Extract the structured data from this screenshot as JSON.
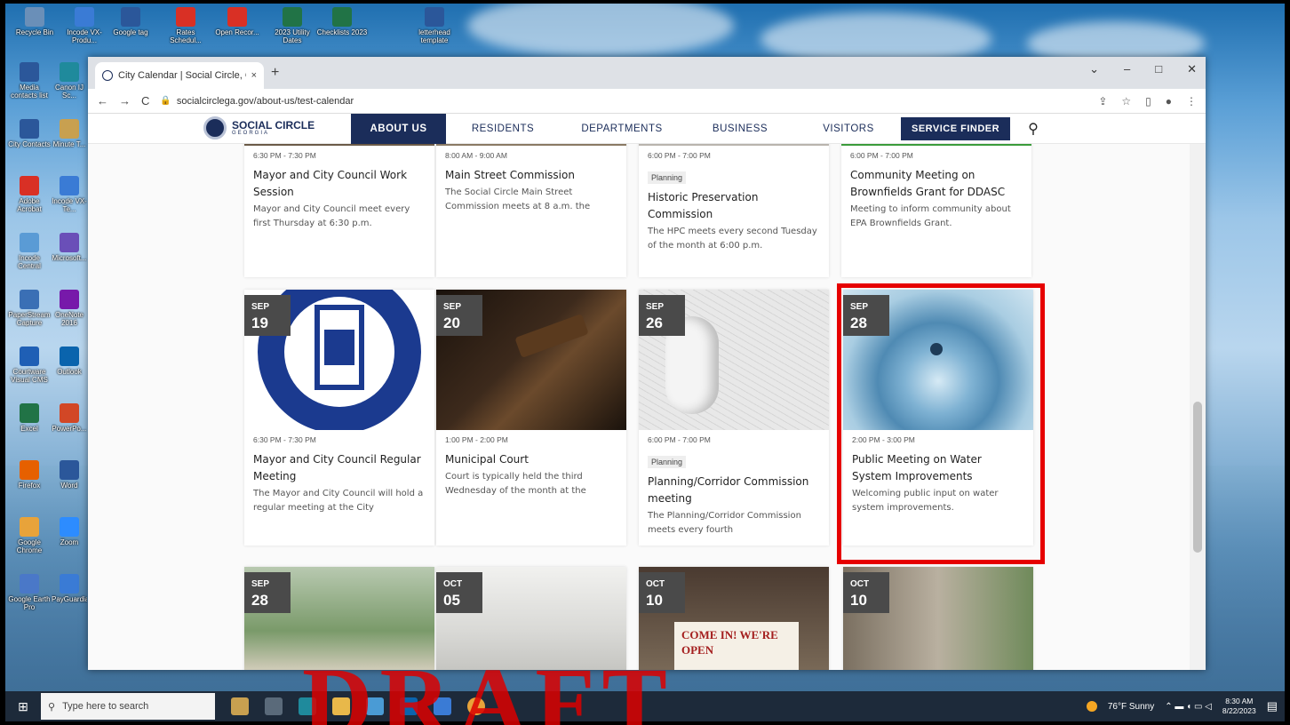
{
  "desktop": {
    "top_icons": [
      {
        "label": "Recycle Bin",
        "icon": "recycle-bin-icon",
        "color": "#6a8fb8"
      },
      {
        "label": "Incode VX-Produ...",
        "icon": "incode-icon",
        "color": "#3a7bd5"
      },
      {
        "label": "Google tag",
        "icon": "word-icon",
        "color": "#2b579a"
      },
      {
        "label": "Rates Schedul...",
        "icon": "pdf-icon",
        "color": "#d93025"
      },
      {
        "label": "Open Recor...",
        "icon": "pdf-icon",
        "color": "#d93025"
      },
      {
        "label": "2023 Utility Dates",
        "icon": "excel-icon",
        "color": "#217346"
      },
      {
        "label": "Checklists 2023",
        "icon": "excel-icon",
        "color": "#217346"
      },
      {
        "label": "letterhead template",
        "icon": "word-icon",
        "color": "#2b579a"
      }
    ],
    "left_icons": [
      {
        "label": "Media contacts list",
        "icon": "word-icon",
        "color": "#2b579a"
      },
      {
        "label": "Canon IJ Sc...",
        "icon": "edge-icon",
        "color": "#1f8a9c"
      },
      {
        "label": "City Contacts",
        "icon": "word-icon",
        "color": "#2b579a"
      },
      {
        "label": "Minute T...",
        "icon": "minute-icon",
        "color": "#c8a050"
      },
      {
        "label": "Adobe Acrobat",
        "icon": "pdf-icon",
        "color": "#d93025"
      },
      {
        "label": "Incode VX-Te...",
        "icon": "incode-icon",
        "color": "#3a7bd5"
      },
      {
        "label": "Incode Central",
        "icon": "incode-central-icon",
        "color": "#5a9bd5"
      },
      {
        "label": "Microsoft...",
        "icon": "microsoft-icon",
        "color": "#6a4fb8"
      },
      {
        "label": "PaperStream Capture",
        "icon": "paperstream-icon",
        "color": "#3a6fb5"
      },
      {
        "label": "OneNote 2016",
        "icon": "onenote-icon",
        "color": "#7719aa"
      },
      {
        "label": "Courtware Visual CMS",
        "icon": "courtware-icon",
        "color": "#1f5fb5"
      },
      {
        "label": "Outlook",
        "icon": "outlook-icon",
        "color": "#0a64ad"
      },
      {
        "label": "Excel",
        "icon": "excel-icon",
        "color": "#217346"
      },
      {
        "label": "PowerPo...",
        "icon": "powerpoint-icon",
        "color": "#d24726"
      },
      {
        "label": "Firefox",
        "icon": "firefox-icon",
        "color": "#e66000"
      },
      {
        "label": "Word",
        "icon": "word-icon",
        "color": "#2b579a"
      },
      {
        "label": "Google Chrome",
        "icon": "chrome-icon",
        "color": "#e8a33a"
      },
      {
        "label": "Zoom",
        "icon": "zoom-icon",
        "color": "#2d8cff"
      },
      {
        "label": "Google Earth Pro",
        "icon": "google-earth-icon",
        "color": "#4a78c8"
      },
      {
        "label": "PayGuardian",
        "icon": "payguardian-icon",
        "color": "#3a7bd5"
      }
    ]
  },
  "browser": {
    "tab_title": "City Calendar | Social Circle, GA",
    "tab_close": "×",
    "new_tab": "+",
    "url": "socialcirclega.gov/about-us/test-calendar",
    "nav_back": "←",
    "nav_forward": "→",
    "nav_reload": "C",
    "win_min": "–",
    "win_max": "□",
    "win_close": "✕",
    "win_menu": "⌄"
  },
  "site": {
    "logo_name": "SOCIAL CIRCLE",
    "logo_sub": "GEORGIA",
    "nav": [
      {
        "label": "ABOUT US",
        "active": true
      },
      {
        "label": "RESIDENTS"
      },
      {
        "label": "DEPARTMENTS"
      },
      {
        "label": "BUSINESS"
      },
      {
        "label": "VISITORS"
      }
    ],
    "service_finder": "SERVICE FINDER",
    "search_icon": "⚲"
  },
  "events_row1": [
    {
      "time": "6:30 PM - 7:30 PM",
      "tag": "",
      "title": "Mayor and City Council Work Session",
      "desc": "Mayor and City Council meet every first Thursday at 6:30 p.m."
    },
    {
      "time": "8:00 AM - 9:00 AM",
      "tag": "",
      "title": "Main Street Commission",
      "desc": "The Social Circle Main Street Commission meets at 8 a.m. the"
    },
    {
      "time": "6:00 PM - 7:00 PM",
      "tag": "Planning",
      "title": "Historic Preservation Commission",
      "desc": "The HPC meets every second Tuesday of the month at 6:00 p.m."
    },
    {
      "time": "6:00 PM - 7:00 PM",
      "tag": "",
      "title": "Community Meeting on Brownfields Grant for DDASC",
      "desc": "Meeting to inform community about EPA Brownfields Grant."
    }
  ],
  "events_row2": [
    {
      "mon": "SEP",
      "day": "19",
      "time": "6:30 PM - 7:30 PM",
      "tag": "",
      "title": "Mayor and City Council Regular Meeting",
      "desc": "The Mayor and City Council will hold a regular meeting at the City"
    },
    {
      "mon": "SEP",
      "day": "20",
      "time": "1:00 PM - 2:00 PM",
      "tag": "",
      "title": "Municipal Court",
      "desc": "Court is typically held the third Wednesday of the month at the"
    },
    {
      "mon": "SEP",
      "day": "26",
      "time": "6:00 PM - 7:00 PM",
      "tag": "Planning",
      "title": "Planning/Corridor Commission meeting",
      "desc": "The Planning/Corridor Commission meets every fourth"
    },
    {
      "mon": "SEP",
      "day": "28",
      "time": "2:00 PM - 3:00 PM",
      "tag": "",
      "title": "Public Meeting on Water System Improvements",
      "desc": "Welcoming public input on water system improvements."
    }
  ],
  "events_row3": [
    {
      "mon": "SEP",
      "day": "28"
    },
    {
      "mon": "OCT",
      "day": "05"
    },
    {
      "mon": "OCT",
      "day": "10",
      "sign": "COME IN! WE'RE OPEN"
    },
    {
      "mon": "OCT",
      "day": "10"
    }
  ],
  "taskbar": {
    "search_placeholder": "Type here to search",
    "weather": "76°F  Sunny",
    "time": "8:30 AM",
    "date": "8/22/2023"
  },
  "watermark": "DRAFT",
  "colors": {
    "navy": "#1b2d5a",
    "highlight": "#e60000",
    "date_badge": "#4a4a4a"
  }
}
